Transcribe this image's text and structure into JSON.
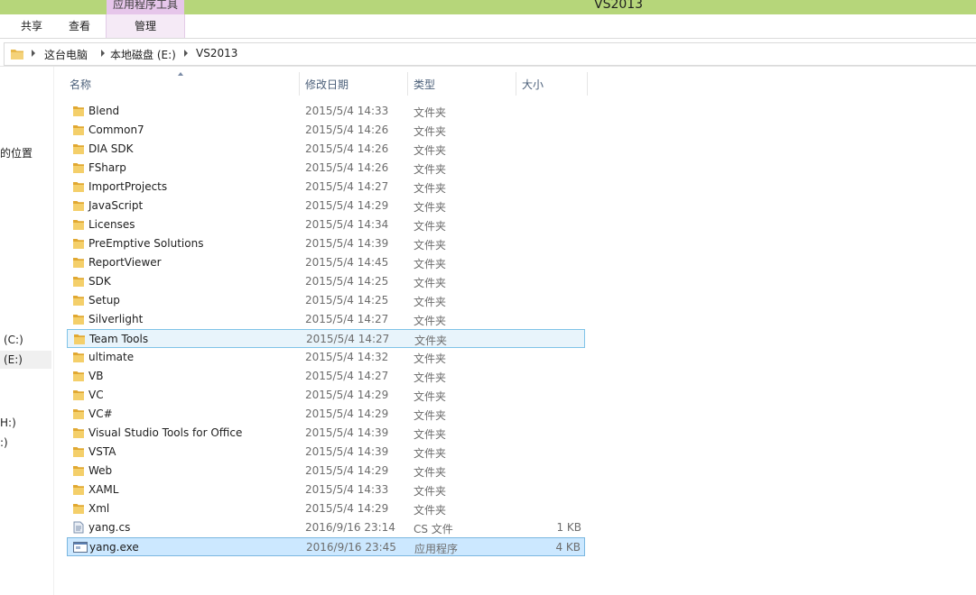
{
  "window": {
    "title": "VS2013"
  },
  "ribbon": {
    "context_group": "应用程序工具",
    "tabs": [
      "共享",
      "查看",
      "管理"
    ]
  },
  "address": {
    "crumbs": [
      "这台电脑",
      "本地磁盘 (E:)",
      "VS2013"
    ]
  },
  "nav": {
    "items": [
      "的位置",
      "(C:)",
      "(E:)",
      "H:)",
      ":)"
    ]
  },
  "columns": {
    "name": "名称",
    "date": "修改日期",
    "type": "类型",
    "size": "大小"
  },
  "files": [
    {
      "name": "Blend",
      "date": "2015/5/4 14:33",
      "type": "文件夹",
      "size": "",
      "icon": "folder-icon"
    },
    {
      "name": "Common7",
      "date": "2015/5/4 14:26",
      "type": "文件夹",
      "size": "",
      "icon": "folder-icon"
    },
    {
      "name": "DIA SDK",
      "date": "2015/5/4 14:26",
      "type": "文件夹",
      "size": "",
      "icon": "folder-icon"
    },
    {
      "name": "FSharp",
      "date": "2015/5/4 14:26",
      "type": "文件夹",
      "size": "",
      "icon": "folder-icon"
    },
    {
      "name": "ImportProjects",
      "date": "2015/5/4 14:27",
      "type": "文件夹",
      "size": "",
      "icon": "folder-icon"
    },
    {
      "name": "JavaScript",
      "date": "2015/5/4 14:29",
      "type": "文件夹",
      "size": "",
      "icon": "folder-icon"
    },
    {
      "name": "Licenses",
      "date": "2015/5/4 14:34",
      "type": "文件夹",
      "size": "",
      "icon": "folder-icon"
    },
    {
      "name": "PreEmptive Solutions",
      "date": "2015/5/4 14:39",
      "type": "文件夹",
      "size": "",
      "icon": "folder-icon"
    },
    {
      "name": "ReportViewer",
      "date": "2015/5/4 14:45",
      "type": "文件夹",
      "size": "",
      "icon": "folder-icon"
    },
    {
      "name": "SDK",
      "date": "2015/5/4 14:25",
      "type": "文件夹",
      "size": "",
      "icon": "folder-icon"
    },
    {
      "name": "Setup",
      "date": "2015/5/4 14:25",
      "type": "文件夹",
      "size": "",
      "icon": "folder-icon"
    },
    {
      "name": "Silverlight",
      "date": "2015/5/4 14:27",
      "type": "文件夹",
      "size": "",
      "icon": "folder-icon"
    },
    {
      "name": "Team Tools",
      "date": "2015/5/4 14:27",
      "type": "文件夹",
      "size": "",
      "icon": "folder-icon",
      "state": "hover"
    },
    {
      "name": "ultimate",
      "date": "2015/5/4 14:32",
      "type": "文件夹",
      "size": "",
      "icon": "folder-icon"
    },
    {
      "name": "VB",
      "date": "2015/5/4 14:27",
      "type": "文件夹",
      "size": "",
      "icon": "folder-icon"
    },
    {
      "name": "VC",
      "date": "2015/5/4 14:29",
      "type": "文件夹",
      "size": "",
      "icon": "folder-icon"
    },
    {
      "name": "VC#",
      "date": "2015/5/4 14:29",
      "type": "文件夹",
      "size": "",
      "icon": "folder-icon"
    },
    {
      "name": "Visual Studio Tools for Office",
      "date": "2015/5/4 14:39",
      "type": "文件夹",
      "size": "",
      "icon": "folder-icon"
    },
    {
      "name": "VSTA",
      "date": "2015/5/4 14:39",
      "type": "文件夹",
      "size": "",
      "icon": "folder-icon"
    },
    {
      "name": "Web",
      "date": "2015/5/4 14:29",
      "type": "文件夹",
      "size": "",
      "icon": "folder-icon"
    },
    {
      "name": "XAML",
      "date": "2015/5/4 14:33",
      "type": "文件夹",
      "size": "",
      "icon": "folder-icon"
    },
    {
      "name": "Xml",
      "date": "2015/5/4 14:29",
      "type": "文件夹",
      "size": "",
      "icon": "folder-icon"
    },
    {
      "name": "yang.cs",
      "date": "2016/9/16 23:14",
      "type": "CS 文件",
      "size": "1 KB",
      "icon": "cs-file-icon"
    },
    {
      "name": "yang.exe",
      "date": "2016/9/16 23:45",
      "type": "应用程序",
      "size": "4 KB",
      "icon": "exe-file-icon",
      "state": "selected"
    }
  ]
}
